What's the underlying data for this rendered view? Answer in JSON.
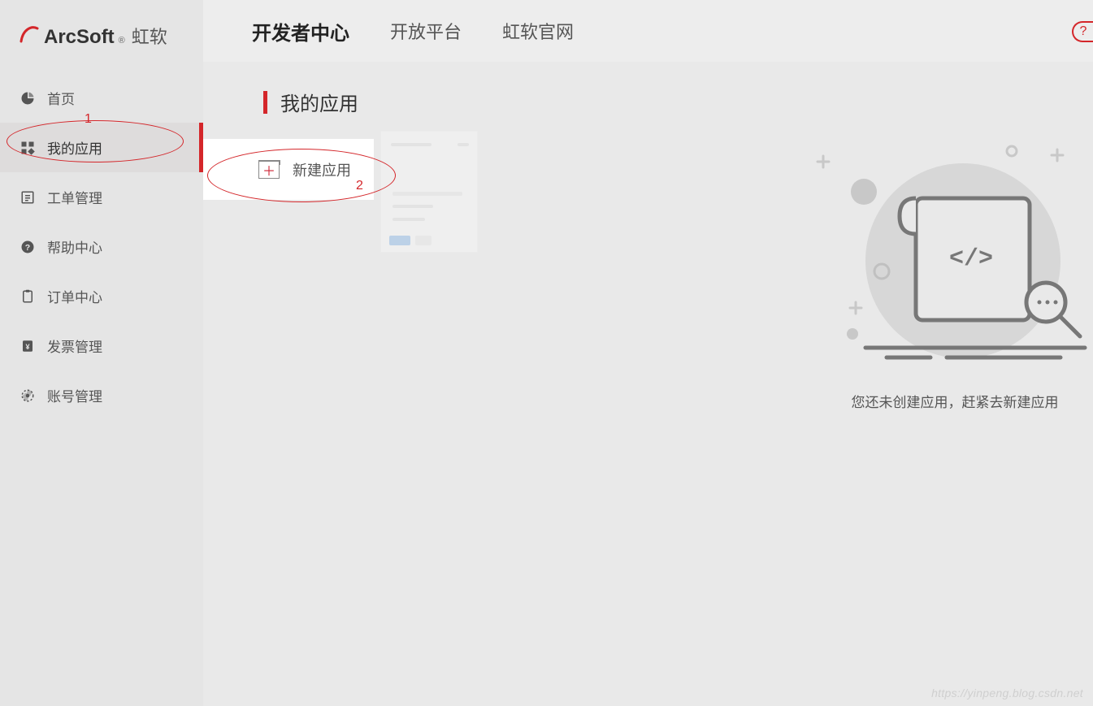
{
  "brand": {
    "name": "ArcSoft",
    "reg": "®",
    "cn": "虹软"
  },
  "sidebar": {
    "items": [
      {
        "label": "首页",
        "icon": "pie-icon"
      },
      {
        "label": "我的应用",
        "icon": "apps-icon",
        "active": true
      },
      {
        "label": "工单管理",
        "icon": "ticket-icon"
      },
      {
        "label": "帮助中心",
        "icon": "help-icon"
      },
      {
        "label": "订单中心",
        "icon": "clipboard-icon"
      },
      {
        "label": "发票管理",
        "icon": "invoice-icon"
      },
      {
        "label": "账号管理",
        "icon": "gear-icon"
      }
    ]
  },
  "topnav": {
    "items": [
      {
        "label": "开发者中心",
        "active": true
      },
      {
        "label": "开放平台"
      },
      {
        "label": "虹软官网"
      }
    ],
    "help_tooltip": "?"
  },
  "page": {
    "title": "我的应用"
  },
  "actions": {
    "new_app_label": "新建应用"
  },
  "empty_state": {
    "message": "您还未创建应用，赶紧去新建应用"
  },
  "annotations": {
    "marker1": "1",
    "marker2": "2"
  },
  "watermark": "https://yinpeng.blog.csdn.net"
}
